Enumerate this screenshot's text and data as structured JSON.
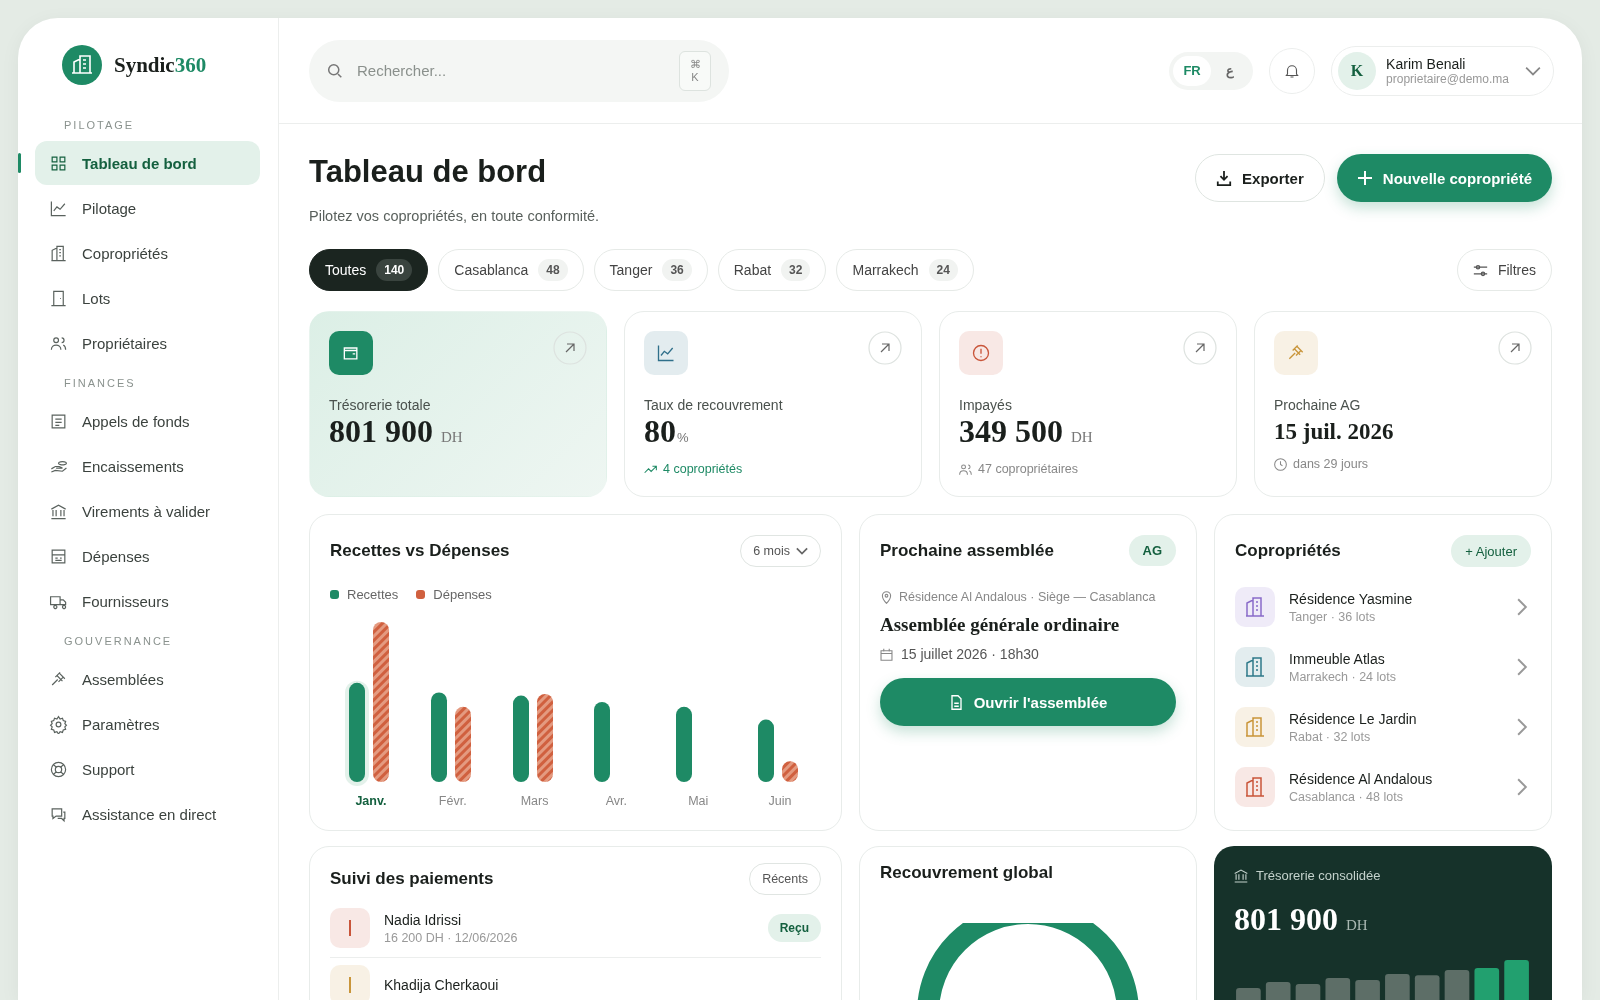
{
  "brand": {
    "name": "Syndic",
    "accent": "360"
  },
  "search": {
    "placeholder": "Rechercher...",
    "shortcut_symbol": "⌘",
    "shortcut_key": "K"
  },
  "languages": [
    {
      "label": "FR",
      "selected": true
    },
    {
      "label": "ع",
      "selected": false
    }
  ],
  "user": {
    "initial": "K",
    "name": "Karim Benali",
    "email": "proprietaire@demo.ma"
  },
  "sidebar": {
    "sections": [
      {
        "title": "PILOTAGE",
        "items": [
          {
            "label": "Tableau de bord",
            "selected": true
          },
          {
            "label": "Pilotage",
            "selected": false
          },
          {
            "label": "Copropriétés",
            "selected": false
          },
          {
            "label": "Lots",
            "selected": false
          },
          {
            "label": "Propriétaires",
            "selected": false
          }
        ]
      },
      {
        "title": "FINANCES",
        "items": [
          {
            "label": "Appels de fonds",
            "selected": false
          },
          {
            "label": "Encaissements",
            "selected": false
          },
          {
            "label": "Virements à valider",
            "selected": false
          },
          {
            "label": "Dépenses",
            "selected": false
          },
          {
            "label": "Fournisseurs",
            "selected": false
          }
        ]
      },
      {
        "title": "GOUVERNANCE",
        "items": [
          {
            "label": "Assemblées",
            "selected": false
          },
          {
            "label": "Paramètres",
            "selected": false
          },
          {
            "label": "Support",
            "selected": false
          },
          {
            "label": "Assistance en direct",
            "selected": false
          }
        ]
      }
    ]
  },
  "page": {
    "title": "Tableau de bord",
    "subtitle": "Pilotez vos copropriétés, en toute conformité.",
    "buttons": [
      {
        "label": "Exporter",
        "kind": "secondary"
      },
      {
        "label": "Nouvelle copropriété",
        "kind": "primary"
      }
    ]
  },
  "filters": [
    {
      "label": "Toutes",
      "count": "140",
      "selected": true
    },
    {
      "label": "Casablanca",
      "count": "48",
      "selected": false
    },
    {
      "label": "Tanger",
      "count": "36",
      "selected": false
    },
    {
      "label": "Rabat",
      "count": "32",
      "selected": false
    },
    {
      "label": "Marrakech",
      "count": "24",
      "selected": false
    }
  ],
  "filter_button": "Filtres",
  "stats": [
    {
      "label": "Trésorerie totale",
      "value": "801 900",
      "unit": "DH",
      "color": "#1e8a65",
      "selected": true
    },
    {
      "label": "Taux de recouvrement",
      "value": "80",
      "unit": "%",
      "color": "#2f6f8a",
      "selected": false,
      "note": "4 copropriétés"
    },
    {
      "label": "Impayés",
      "value": "349 500",
      "unit": "DH",
      "color": "#c9553a",
      "selected": false,
      "note": "47 copropriétaires"
    },
    {
      "label": "Prochaine AG",
      "value": "15 juil. 2026",
      "color": "#c9953a",
      "selected": false,
      "note": "dans 29 jours"
    }
  ],
  "revenue_chart": {
    "title": "Recettes vs Dépenses",
    "period": "6 mois",
    "legend": [
      {
        "label": "Recettes",
        "color": "#1e8a65"
      },
      {
        "label": "Dépenses",
        "color": "#d0603f"
      }
    ],
    "months": [
      {
        "label": "Janv.",
        "selected": true
      },
      {
        "label": "Févr.",
        "selected": false
      },
      {
        "label": "Mars",
        "selected": false
      },
      {
        "label": "Avr.",
        "selected": false
      },
      {
        "label": "Mai",
        "selected": false
      },
      {
        "label": "Juin",
        "selected": false
      }
    ]
  },
  "assembly": {
    "title": "Prochaine assemblée",
    "badge": "AG",
    "location": "Résidence Al Andalous · Siège — Casablanca",
    "name": "Assemblée générale ordinaire",
    "date": "15 juillet 2026 · 18h30",
    "button": "Ouvrir l'assemblée"
  },
  "properties": {
    "title": "Copropriétés",
    "add": "Ajouter",
    "add_symbol": "+",
    "items": [
      {
        "name": "Résidence Yasmine",
        "detail": "Tanger · 36 lots",
        "color": "#8a6cc9"
      },
      {
        "name": "Immeuble Atlas",
        "detail": "Marrakech · 24 lots",
        "color": "#2f7a8a"
      },
      {
        "name": "Résidence Le Jardin",
        "detail": "Rabat · 32 lots",
        "color": "#c9953a"
      },
      {
        "name": "Résidence Al Andalous",
        "detail": "Casablanca · 48 lots",
        "color": "#c9553a"
      }
    ]
  },
  "payments": {
    "title": "Suivi des paiements",
    "filter": "Récents",
    "items": [
      {
        "name": "Nadia Idrissi",
        "detail": "16 200 DH · 12/06/2026",
        "status": "Reçu",
        "color": "#c9553a"
      },
      {
        "name": "Khadija Cherkaoui",
        "color": "#c9953a"
      }
    ]
  },
  "recovery": {
    "title": "Recouvrement global"
  },
  "treasury": {
    "title": "Trésorerie consolidée",
    "value": "801 900",
    "unit": "DH"
  }
}
